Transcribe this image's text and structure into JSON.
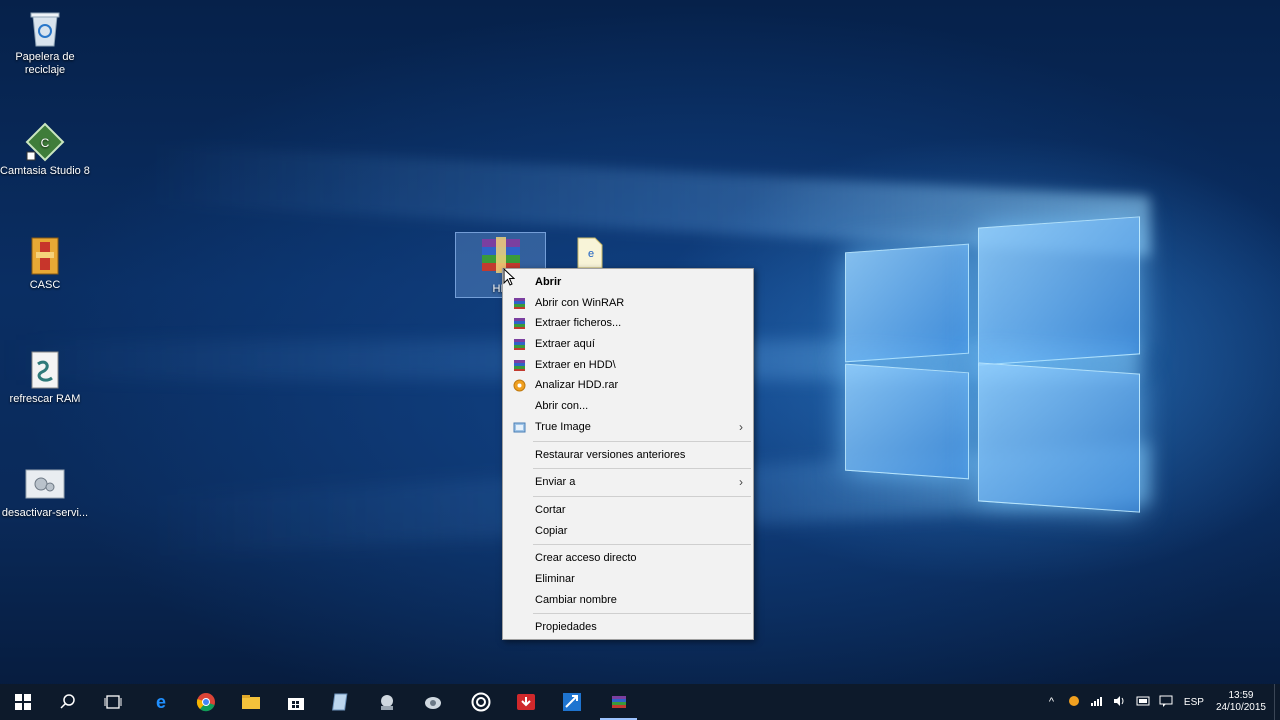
{
  "desktop": {
    "icons": [
      {
        "label": "Papelera de reciclaje",
        "icon": "recycle-bin-icon"
      },
      {
        "label": "Camtasia Studio 8",
        "icon": "camtasia-icon"
      },
      {
        "label": "CASC",
        "icon": "winrar-sfx-icon"
      },
      {
        "label": "refrescar RAM",
        "icon": "script-icon"
      },
      {
        "label": "desactivar-servi...",
        "icon": "settings-file-icon"
      }
    ],
    "selected_file": {
      "label": "HD",
      "icon": "winrar-archive-icon"
    },
    "second_file": {
      "icon": "text-file-icon"
    }
  },
  "context_menu": {
    "items": [
      {
        "label": "Abrir",
        "bold": true
      },
      {
        "label": "Abrir con WinRAR",
        "icon": "winrar-icon"
      },
      {
        "label": "Extraer ficheros...",
        "icon": "winrar-icon"
      },
      {
        "label": "Extraer aquí",
        "icon": "winrar-icon"
      },
      {
        "label": "Extraer en HDD\\",
        "icon": "winrar-icon"
      },
      {
        "label": "Analizar HDD.rar",
        "icon": "antivirus-icon"
      },
      {
        "label": "Abrir con..."
      },
      {
        "label": "True Image",
        "icon": "true-image-icon",
        "submenu": true
      },
      {
        "label": "Restaurar versiones anteriores"
      },
      {
        "label": "Enviar a",
        "submenu": true
      },
      {
        "label": "Cortar"
      },
      {
        "label": "Copiar"
      },
      {
        "label": "Crear acceso directo"
      },
      {
        "label": "Eliminar"
      },
      {
        "label": "Cambiar nombre"
      },
      {
        "label": "Propiedades"
      }
    ]
  },
  "taskbar": {
    "buttons": [
      "start-icon",
      "search-icon",
      "task-view-icon",
      "edge-icon",
      "chrome-icon",
      "file-explorer-icon",
      "store-icon",
      "notepad-icon",
      "network-icon",
      "mixer-icon",
      "media-player-icon",
      "download-manager-icon",
      "ftp-icon",
      "winrar-taskbar-icon"
    ],
    "tray": {
      "language": "ESP",
      "time": "13:59",
      "date": "24/10/2015"
    }
  },
  "colors": {
    "menu_bg": "#f2f2f2",
    "taskbar_bg": "#0d1a2b",
    "accent": "#9cc3ff"
  }
}
